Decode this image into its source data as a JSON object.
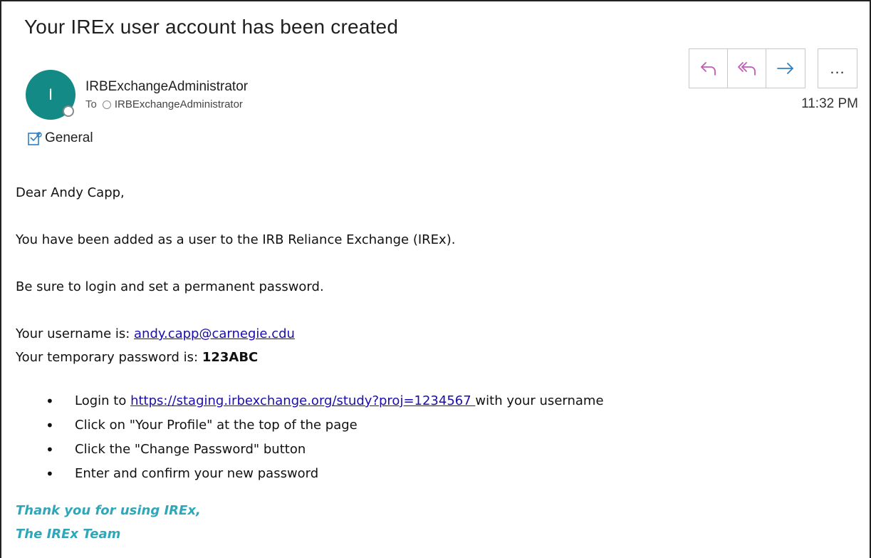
{
  "email": {
    "subject": "Your IREx user account has been created",
    "sender": {
      "avatar_initial": "I",
      "name": "IRBExchangeAdministrator",
      "to_label": "To",
      "to_recipient": "IRBExchangeAdministrator"
    },
    "time": "11:32 PM",
    "category": "General",
    "actions": {
      "reply": "reply-icon",
      "reply_all": "reply-all-icon",
      "forward": "forward-icon",
      "more": "..."
    },
    "body": {
      "greeting": "Dear Andy Capp,",
      "line1": "You have been added as a user to the IRB Reliance Exchange (IREx).",
      "line2": "Be sure to login and set a permanent password.",
      "username_label": "Your username is: ",
      "username": "andy.capp@carnegie.cdu",
      "password_label": "Your temporary password is: ",
      "password": "123ABC",
      "steps": {
        "step1_prefix": "Login to ",
        "step1_link": "https://staging.irbexchange.org/study?proj=1234567 ",
        "step1_suffix": "with your username",
        "step2": "Click on \"Your Profile\" at the top of the page",
        "step3": "Click the \"Change Password\" button",
        "step4": "Enter and confirm your new password"
      },
      "signoff1": "Thank you for using IREx,",
      "signoff2": "The IREx Team"
    },
    "colors": {
      "avatar": "#138a85",
      "action_icons": "#c25bb8",
      "forward_icon": "#2f7fc0",
      "link": "#1a0dab",
      "signoff": "#2fa7b8"
    }
  }
}
